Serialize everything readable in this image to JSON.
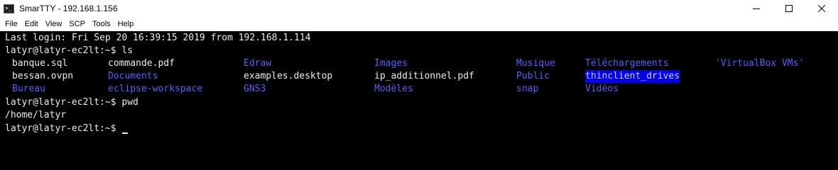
{
  "window": {
    "title": "SmarTTY - 192.168.1.156",
    "app_icon_glyph": ">_"
  },
  "menu": {
    "items": [
      "File",
      "Edit",
      "View",
      "SCP",
      "Tools",
      "Help"
    ]
  },
  "terminal": {
    "last_login": "Last login: Fri Sep 20 16:39:15 2019 from 192.168.1.114",
    "prompt": "latyr@latyr-ec2lt:~$",
    "cmd_ls": " ls",
    "ls_rows": [
      [
        "banque.sql",
        "commande.pdf",
        "Edraw",
        "Images",
        "Musique",
        "Téléchargements",
        "'VirtualBox VMs'"
      ],
      [
        "bessan.ovpn",
        "Documents",
        "examples.desktop",
        "ip_additionnel.pdf",
        "Public",
        "thinclient_drives",
        ""
      ],
      [
        "Bureau",
        "eclipse-workspace",
        "GNS3",
        "Modèles",
        "snap",
        "Vidéos",
        ""
      ]
    ],
    "cmd_pwd": " pwd",
    "pwd_output": "/home/latyr",
    "final_prompt_suffix": " "
  },
  "colors": {
    "background": "#000000",
    "text": "#ececec",
    "directory": "#5c5cff",
    "highlight_bg": "#0000ee"
  }
}
